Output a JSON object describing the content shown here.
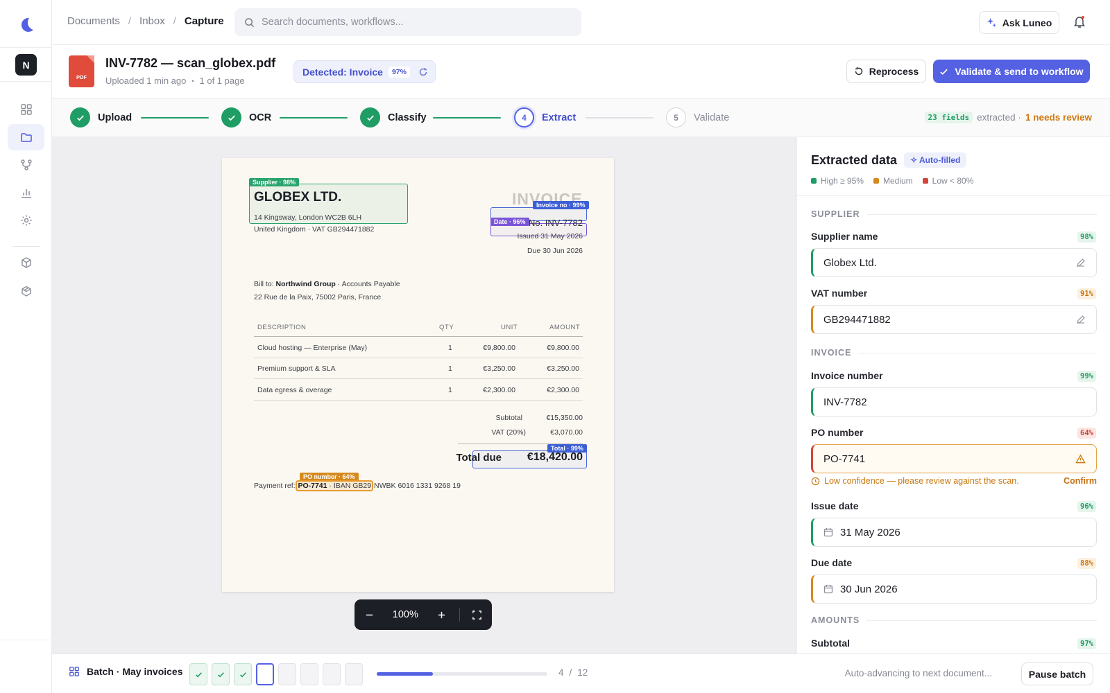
{
  "breadcrumb": {
    "items": [
      "Documents",
      "Inbox"
    ],
    "current": "Capture",
    "sep": "/"
  },
  "search": {
    "placeholder": "Search documents, workflows..."
  },
  "ask_button": "Ask Luneo",
  "org_initial": "N",
  "document": {
    "title": "INV-7782 — scan_globex.pdf",
    "file_type": "PDF",
    "uploaded": "Uploaded 1 min ago",
    "pages": "1 of 1 page",
    "bullet": "•",
    "detected": "Detected: Invoice",
    "detected_pct": "97%"
  },
  "actions": {
    "reprocess": "Reprocess",
    "validate": "Validate & send to workflow"
  },
  "steps": [
    {
      "num": "1",
      "label": "Upload",
      "state": "done"
    },
    {
      "num": "2",
      "label": "OCR",
      "state": "done"
    },
    {
      "num": "3",
      "label": "Classify",
      "state": "done"
    },
    {
      "num": "4",
      "label": "Extract",
      "state": "current"
    },
    {
      "num": "5",
      "label": "Validate",
      "state": "todo"
    }
  ],
  "summary": {
    "fields": "23 fields",
    "extracted": "extracted ·",
    "needs_review": "1 needs review"
  },
  "invoice": {
    "supplier_tag": "Supplier · 98%",
    "supplier_name": "GLOBEX LTD.",
    "supplier_addr1": "14 Kingsway, London WC2B 6LH",
    "supplier_addr2": "United Kingdom · VAT GB294471882",
    "heading": "INVOICE",
    "invoice_tag": "Invoice no · 99%",
    "date_tag": "Date · 96%",
    "invoice_no": "No. INV-7782",
    "issued": "Issued 31 May 2026",
    "due": "Due 30 Jun 2026",
    "bill_to_prefix": "Bill to:",
    "bill_to_name": "Northwind Group",
    "bill_to_suffix": "· Accounts Payable",
    "bill_to_addr": "22 Rue de la Paix, 75002 Paris, France",
    "columns": [
      "DESCRIPTION",
      "QTY",
      "UNIT",
      "AMOUNT"
    ],
    "rows": [
      {
        "desc": "Cloud hosting — Enterprise (May)",
        "qty": "1",
        "unit": "€9,800.00",
        "amount": "€9,800.00"
      },
      {
        "desc": "Premium support & SLA",
        "qty": "1",
        "unit": "€3,250.00",
        "amount": "€3,250.00"
      },
      {
        "desc": "Data egress & overage",
        "qty": "1",
        "unit": "€2,300.00",
        "amount": "€2,300.00"
      }
    ],
    "subtotal_label": "Subtotal",
    "subtotal": "€15,350.00",
    "vat_label": "VAT (20%)",
    "vat": "€3,070.00",
    "total_tag": "Total · 99%",
    "total_label": "Total due",
    "total": "€18,420.00",
    "po_tag": "PO number · 64%",
    "payment_prefix": "Payment ref:",
    "payment_po": "PO-7741",
    "payment_iban_hl": "· IBAN GB29",
    "payment_rest": "NWBK 6016 1331 9268 19"
  },
  "zoom": {
    "value": "100%"
  },
  "panel": {
    "title": "Extracted data",
    "badge": "Auto-filled",
    "legend": [
      "High ≥ 95%",
      "Medium",
      "Low < 80%"
    ],
    "sections": {
      "supplier": "SUPPLIER",
      "invoice": "INVOICE",
      "amounts": "AMOUNTS"
    },
    "fields": {
      "supplier_name": {
        "label": "Supplier name",
        "pct": "98%",
        "value": "Globex Ltd."
      },
      "vat_number": {
        "label": "VAT number",
        "pct": "91%",
        "value": "GB294471882"
      },
      "invoice_number": {
        "label": "Invoice number",
        "pct": "99%",
        "value": "INV-7782"
      },
      "po_number": {
        "label": "PO number",
        "pct": "64%",
        "value": "PO-7741"
      },
      "issue_date": {
        "label": "Issue date",
        "pct": "96%",
        "value": "31 May 2026"
      },
      "due_date": {
        "label": "Due date",
        "pct": "88%",
        "value": "30 Jun 2026"
      },
      "subtotal": {
        "label": "Subtotal",
        "pct": "97%"
      }
    },
    "warning": "Low confidence — please review against the scan.",
    "confirm": "Confirm"
  },
  "batch": {
    "label": "Batch · May invoices",
    "progress": 0.33,
    "current": "4",
    "slash": "/",
    "total": "12",
    "auto_text": "Auto-advancing to next document...",
    "pause": "Pause batch"
  },
  "colors": {
    "accent": "#5461e3",
    "high": "#1f9d65",
    "medium": "#d68a1d",
    "low": "#d1453a"
  }
}
